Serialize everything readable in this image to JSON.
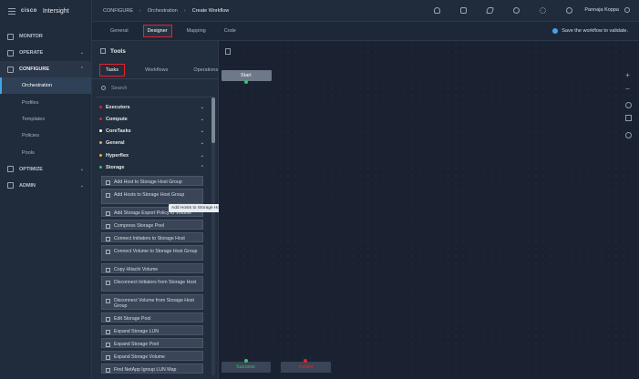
{
  "brand": {
    "logo": "cisco",
    "name": "Intersight"
  },
  "leftnav": {
    "sections": [
      {
        "label": "MONITOR",
        "icon": "monitor-icon"
      },
      {
        "label": "OPERATE",
        "icon": "operate-icon"
      },
      {
        "label": "CONFIGURE",
        "icon": "configure-icon"
      }
    ],
    "configure_items": [
      "Orchestration",
      "Profiles",
      "Templates",
      "Policies",
      "Pools"
    ],
    "bottom_sections": [
      {
        "label": "OPTIMIZE",
        "icon": "optimize-icon"
      },
      {
        "label": "ADMIN",
        "icon": "admin-icon"
      }
    ]
  },
  "breadcrumb": {
    "items": [
      "CONFIGURE",
      "Orchestration"
    ],
    "current": "Create Workflow"
  },
  "user": {
    "name": "Pannaja Koppa"
  },
  "tabs": [
    "General",
    "Designer",
    "Mapping",
    "Code"
  ],
  "active_tab": "Designer",
  "validate_msg": "Save the workflow to validate.",
  "tools": {
    "title": "Tools",
    "tabs": [
      "Tasks",
      "Workflows",
      "Operations"
    ],
    "active_tab": "Tasks",
    "search_placeholder": "Search",
    "categories": [
      {
        "label": "Executors",
        "color": "#e0242d",
        "chev": "⌄"
      },
      {
        "label": "Compute",
        "color": "#e0242d",
        "chev": "⌄"
      },
      {
        "label": "CoreTasks",
        "color": "#ffffff",
        "chev": "⌄"
      },
      {
        "label": "General",
        "color": "#f2a93b",
        "chev": "⌄"
      },
      {
        "label": "Hyperflex",
        "color": "#f2a93b",
        "chev": "⌄"
      },
      {
        "label": "Storage",
        "color": "#3cc16b",
        "chev": "⌃"
      }
    ],
    "tasks": [
      "Add Host to Storage Host Group",
      "Add Hosts to Storage Host Group",
      "Add Storage Export Policy to Volume",
      "Compress Storage Pool",
      "Connect Initiators to Storage Host",
      "Connect Volume to Storage Host Group",
      "Copy Hitachi Volume",
      "Disconnect Initiators from Storage Host",
      "Disconnect Volume from Storage Host Group",
      "Edit Storage Pool",
      "Expand Storage LUN",
      "Expand Storage Pool",
      "Expand Storage Volume",
      "Find NetApp Igroup LUN Map"
    ],
    "tooltip": "Add Hosts to Storage Host Group"
  },
  "canvas": {
    "start_label": "Start",
    "success_label": "Success",
    "failed_label": "Failed",
    "controls": [
      "zoom-in-icon",
      "zoom-out-icon",
      "layout-icon",
      "grid-icon",
      "search-icon"
    ]
  }
}
